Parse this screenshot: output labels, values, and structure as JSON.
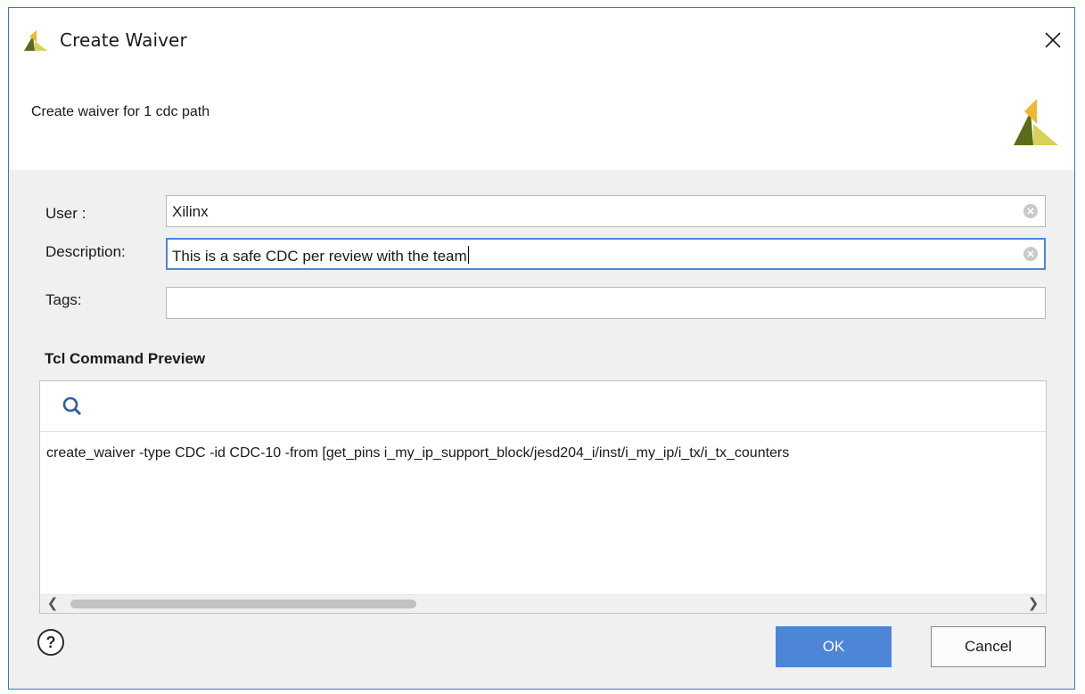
{
  "window": {
    "title": "Create Waiver"
  },
  "header": {
    "subtitle": "Create waiver for 1 cdc path"
  },
  "form": {
    "user_label": "User :",
    "user_value": "Xilinx",
    "description_label": "Description:",
    "description_value": "This is a safe CDC per review with the team",
    "tags_label": "Tags:",
    "tags_value": ""
  },
  "preview": {
    "title": "Tcl Command Preview",
    "command": "create_waiver -type CDC -id CDC-10 -from [get_pins i_my_ip_support_block/jesd204_i/inst/i_my_ip/i_tx/i_tx_counters"
  },
  "buttons": {
    "ok_label": "OK",
    "cancel_label": "Cancel",
    "help_label": "?"
  },
  "colors": {
    "accent": "#4d86d6",
    "window_border": "#2f7bd4",
    "logo_dark": "#5b6b1a",
    "logo_yellow": "#f2b632",
    "logo_light": "#d8d25a"
  },
  "icons": [
    "xilinx-logo-icon",
    "close-icon",
    "search-icon",
    "clear-icon",
    "help-icon",
    "chevron-left-icon",
    "chevron-right-icon"
  ]
}
